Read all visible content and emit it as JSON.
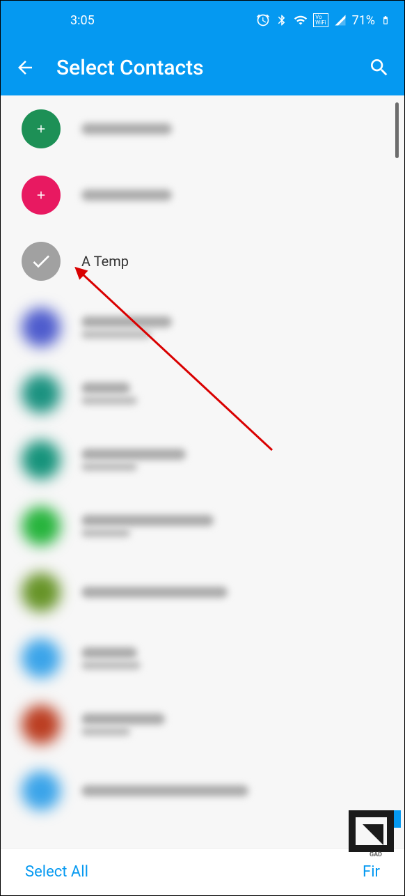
{
  "status": {
    "time": "3:05",
    "battery": "71%"
  },
  "header": {
    "title": "Select Contacts"
  },
  "contacts": [
    {
      "name": "",
      "avatarType": "add-green",
      "blurred": true,
      "lines": 1,
      "w1": 130
    },
    {
      "name": "",
      "avatarType": "add-pink",
      "blurred": true,
      "lines": 1,
      "w1": 130
    },
    {
      "name": "A Temp",
      "avatarType": "selected",
      "blurred": false
    },
    {
      "name": "",
      "avatarType": "blurred-purple",
      "blurred": true,
      "lines": 2,
      "w1": 130,
      "w2": 100
    },
    {
      "name": "",
      "avatarType": "blurred-teal1",
      "blurred": true,
      "lines": 2,
      "w1": 70,
      "w2": 80
    },
    {
      "name": "",
      "avatarType": "blurred-teal2",
      "blurred": true,
      "lines": 2,
      "w1": 150,
      "w2": 80
    },
    {
      "name": "",
      "avatarType": "blurred-green",
      "blurred": true,
      "lines": 2,
      "w1": 190,
      "w2": 70
    },
    {
      "name": "",
      "avatarType": "blurred-olive",
      "blurred": true,
      "lines": 1,
      "w1": 210
    },
    {
      "name": "",
      "avatarType": "blurred-blue",
      "blurred": true,
      "lines": 2,
      "w1": 80,
      "w2": 85
    },
    {
      "name": "",
      "avatarType": "blurred-red",
      "blurred": true,
      "lines": 2,
      "w1": 120,
      "w2": 70
    },
    {
      "name": "",
      "avatarType": "blurred-blue2",
      "blurred": true,
      "lines": 1,
      "w1": 240
    }
  ],
  "footer": {
    "selectAll": "Select All",
    "finish": "Fir"
  }
}
